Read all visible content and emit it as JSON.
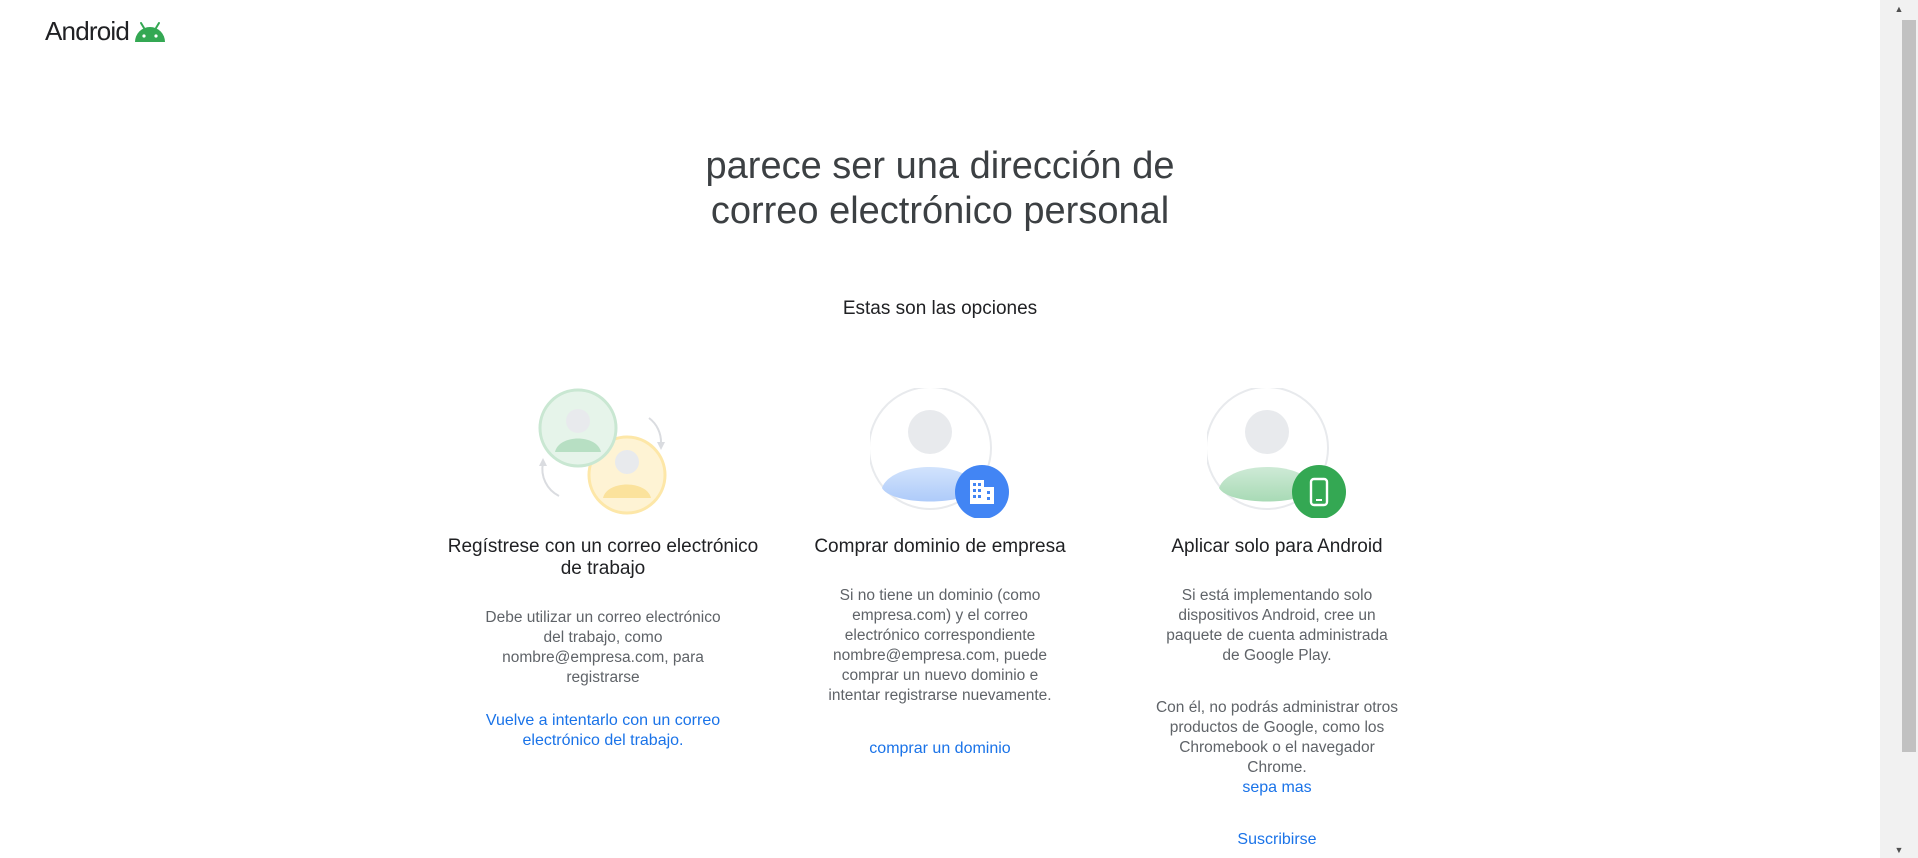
{
  "header": {
    "logo_text": "Android",
    "logo_icon": "android-bot-icon"
  },
  "main": {
    "title_lines": [
      "parece ser una dirección de",
      "correo electrónico personal"
    ],
    "subtitle": "Estas son las opciones"
  },
  "options": [
    {
      "title_lines": [
        "Regístrese con un correo electrónico",
        "de trabajo"
      ],
      "description_lines": [
        "Debe utilizar un correo electrónico",
        "del trabajo, como",
        "nombre@empresa.com, para",
        "registrarse"
      ],
      "link_lines": [
        "Vuelve a intentarlo con un correo",
        "electrónico del trabajo."
      ],
      "icon": "swap-users-icon"
    },
    {
      "title": "Comprar dominio de empresa",
      "description_lines": [
        "Si no tiene un dominio (como",
        "empresa.com) y el correo",
        "electrónico correspondiente",
        "nombre@empresa.com, puede",
        "comprar un nuevo dominio e",
        "intentar registrarse nuevamente."
      ],
      "link": "comprar un dominio",
      "icon": "building-icon"
    },
    {
      "title": "Aplicar solo para Android",
      "description_lines": [
        "Si está implementando solo",
        "dispositivos Android, cree un",
        "paquete de cuenta administrada",
        "de Google Play."
      ],
      "note_lines": [
        "Con él, no podrás administrar otros",
        "productos de Google, como los",
        "Chromebook o el navegador",
        "Chrome."
      ],
      "learn_more": "sepa mas",
      "subscribe": "Suscribirse",
      "icon": "phone-icon"
    }
  ],
  "colors": {
    "link": "#1a73e8",
    "title": "#3c4043",
    "body": "#5f6368",
    "android_green": "#34a853",
    "building_blue": "#4285f4"
  }
}
